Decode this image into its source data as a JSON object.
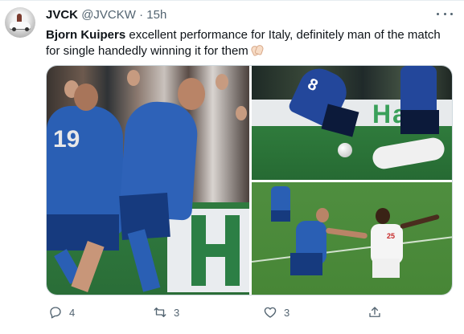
{
  "tweet": {
    "author_name": "JVCK",
    "author_handle": "@JVCKW",
    "separator": "·",
    "time": "15h",
    "text_bold": "Bjorn Kuipers",
    "text_rest": " excellent performance for Italy, definitely man of the match for single handedly winning it for them",
    "emoji_icon": "clapping-hands-icon"
  },
  "media": {
    "left": {
      "jersey_number": "19",
      "board_text": "H"
    },
    "top_right": {
      "jersey_number": "8",
      "board_text": "Ha"
    },
    "bottom_right": {
      "jersey_number": "25"
    }
  },
  "actions": {
    "reply_count": "4",
    "retweet_count": "3",
    "like_count": "3"
  },
  "colors": {
    "text_primary": "#0f1419",
    "text_secondary": "#536471",
    "border": "#cfd9de",
    "italy_blue": "#2a5fb4",
    "pitch_green": "#2f7a3f"
  }
}
